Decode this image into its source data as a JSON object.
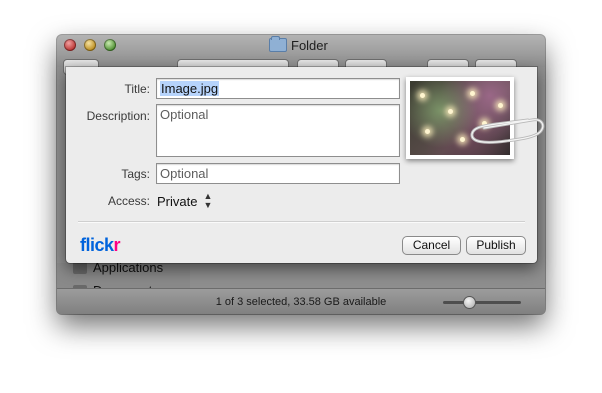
{
  "window": {
    "title": "Folder",
    "sidebar_items": [
      {
        "label": "Applications"
      },
      {
        "label": "Documents"
      }
    ],
    "status": "1 of 3 selected, 33.58 GB available",
    "icon_size_level": 0.3
  },
  "sheet": {
    "title": {
      "label": "Title:",
      "value": "Image.jpg"
    },
    "description": {
      "label": "Description:",
      "placeholder": "Optional"
    },
    "tags": {
      "label": "Tags:",
      "placeholder": "Optional"
    },
    "access": {
      "label": "Access:",
      "value": "Private"
    },
    "logo": {
      "part1": "flick",
      "part2": "r"
    },
    "buttons": {
      "cancel": "Cancel",
      "publish": "Publish"
    }
  },
  "colors": {
    "flickr_blue": "#0063dc",
    "flickr_pink": "#ff0084",
    "selection": "#b6d3fb"
  }
}
